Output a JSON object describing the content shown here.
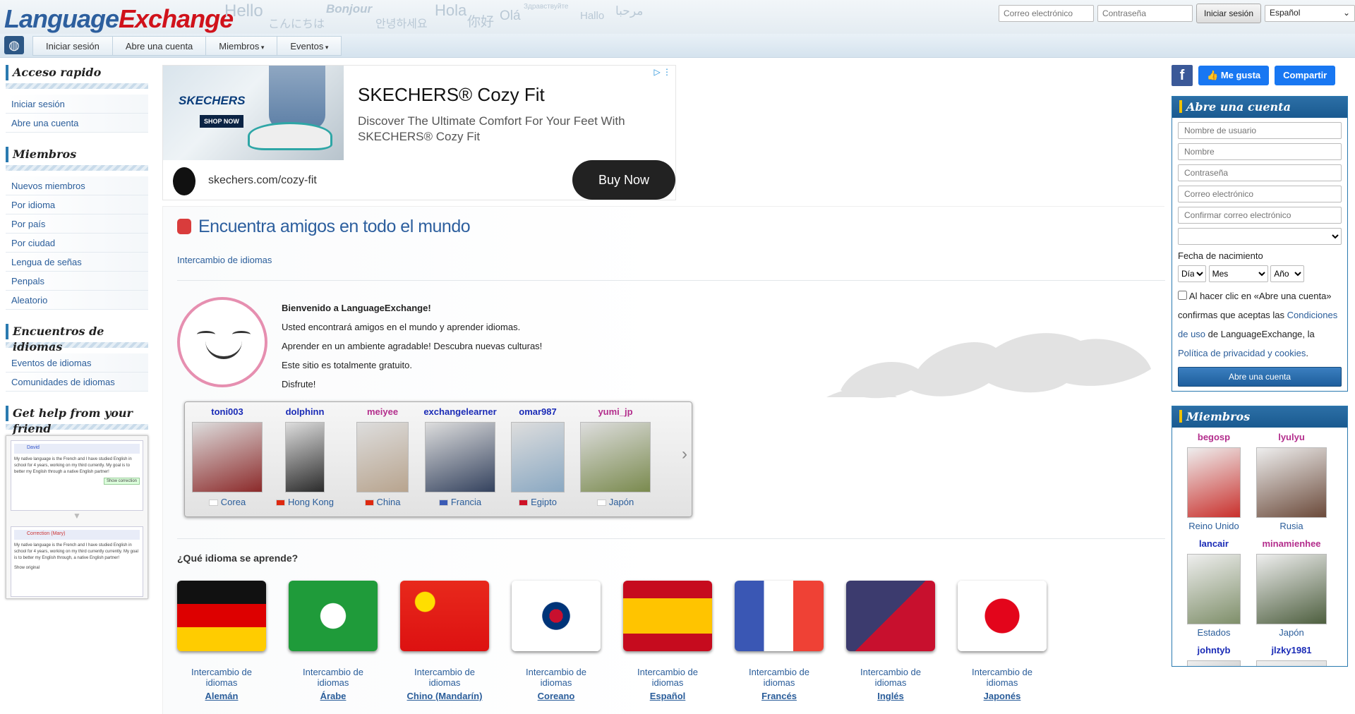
{
  "header": {
    "logo_part1": "Language",
    "logo_part2": "Exchange",
    "greetings": [
      "Hello",
      "こんにちは",
      "Bonjour",
      "안녕하세요",
      "Hola",
      "你好",
      "Olá",
      "Здравствуйте",
      "Hallo",
      "مرحبا"
    ],
    "email_placeholder": "Correo electrónico",
    "password_placeholder": "Contraseña",
    "login_button": "Iniciar sesión",
    "language_select": "Español"
  },
  "nav": {
    "items": [
      "Iniciar sesión",
      "Abre una cuenta",
      "Miembros",
      "Eventos"
    ]
  },
  "left": {
    "quick_title": "Acceso rapido",
    "quick_links": [
      "Iniciar sesión",
      "Abre una cuenta"
    ],
    "members_title": "Miembros",
    "members_links": [
      "Nuevos miembros",
      "Por idioma",
      "Por país",
      "Por ciudad",
      "Lengua de señas",
      "Penpals",
      "Aleatorio"
    ],
    "events_title": "Encuentros de idiomas",
    "events_links": [
      "Eventos de idiomas",
      "Comunidades de idiomas"
    ],
    "help_title": "Get help from your friend",
    "help_box": {
      "user": "David",
      "text": "My native language is the French and I have studied English in school for 4 years, working on my third currently. My goal is to better my English through a native English partner!",
      "show_correction": "Show correction",
      "correction_user": "Correction (Mary)",
      "corrected_text": "My native language is the French and I have studied English in school for 4 years, working on my third currently currently. My goal is to better my English through, a native English partner!",
      "show_original": "Show original"
    }
  },
  "ad": {
    "brand_tag": "SKECHERS",
    "shop_now": "SHOP NOW",
    "title": "SKECHERS® Cozy Fit",
    "description": "Discover The Ultimate Comfort For Your Feet With SKECHERS® Cozy Fit",
    "url": "skechers.com/cozy-fit",
    "cta": "Buy Now"
  },
  "main": {
    "title": "Encuentra amigos en todo el mundo",
    "subtitle": "Intercambio de idiomas",
    "welcome_lines": [
      "Bienvenido a LanguageExchange!",
      "Usted encontrará amigos en el mundo y aprender idiomas.",
      "Aprender en un ambiente agradable! Descubra nuevas culturas!",
      "Este sitio es totalmente gratuito.",
      "Disfrute!"
    ],
    "members": [
      {
        "name": "toni003",
        "country": "Corea",
        "female": false,
        "photo": "#8c2a2a",
        "flag": "#ffffff"
      },
      {
        "name": "dolphinn",
        "country": "Hong Kong",
        "female": false,
        "photo": "#2b2b2b",
        "flag": "#de2910"
      },
      {
        "name": "meiyee",
        "country": "China",
        "female": true,
        "photo": "#b8a48e",
        "flag": "#de2910"
      },
      {
        "name": "exchangelearner",
        "country": "Francia",
        "female": false,
        "photo": "#34425e",
        "flag": "#3b5bb5"
      },
      {
        "name": "omar987",
        "country": "Egipto",
        "female": false,
        "photo": "#8aa8c2",
        "flag": "#ce1126"
      },
      {
        "name": "yumi_jp",
        "country": "Japón",
        "female": true,
        "photo": "#7a8a4e",
        "flag": "#ffffff"
      }
    ],
    "question": "¿Qué idioma se aprende?",
    "languages": [
      {
        "label": "Intercambio de idiomas",
        "name": "Alemán"
      },
      {
        "label": "Intercambio de idiomas",
        "name": "Árabe"
      },
      {
        "label": "Intercambio de idiomas",
        "name": "Chino (Mandarín)"
      },
      {
        "label": "Intercambio de idiomas",
        "name": "Coreano"
      },
      {
        "label": "Intercambio de idiomas",
        "name": "Español"
      },
      {
        "label": "Intercambio de idiomas",
        "name": "Francés"
      },
      {
        "label": "Intercambio de idiomas",
        "name": "Inglés"
      },
      {
        "label": "Intercambio de idiomas",
        "name": "Japonés"
      }
    ]
  },
  "right": {
    "fb_icon": "f",
    "like": "Me gusta",
    "share": "Compartir",
    "signup_title": "Abre una cuenta",
    "username_ph": "Nombre de usuario",
    "name_ph": "Nombre",
    "password_ph": "Contraseña",
    "email_ph": "Correo electrónico",
    "confirm_email_ph": "Confirmar correo electrónico",
    "birthdate_label": "Fecha de nacimiento",
    "day": "Día",
    "month": "Mes",
    "year": "Año",
    "terms_1": "Al hacer clic en «Abre una cuenta» confirmas que aceptas las",
    "terms_link1": "Condiciones de uso",
    "terms_2": "de LanguageExchange, la",
    "terms_link2": "Política de privacidad y cookies",
    "terms_3": ".",
    "signup_button": "Abre una cuenta",
    "members_title": "Miembros",
    "members": [
      {
        "name": "begosp",
        "country": "Reino Unido",
        "female": true,
        "photo": "#c9302c"
      },
      {
        "name": "lyulyu",
        "country": "Rusia",
        "female": true,
        "photo": "#6b4a3a"
      },
      {
        "name": "lancair",
        "country": "Estados",
        "female": false,
        "photo": "#7f8f6a"
      },
      {
        "name": "minamienhee",
        "country": "Japón",
        "female": true,
        "photo": "#4e5f3f"
      },
      {
        "name": "johntyb",
        "country": "",
        "female": false,
        "photo": "#999999"
      },
      {
        "name": "jlzky1981",
        "country": "",
        "female": false,
        "photo": "#cccccc"
      }
    ]
  }
}
